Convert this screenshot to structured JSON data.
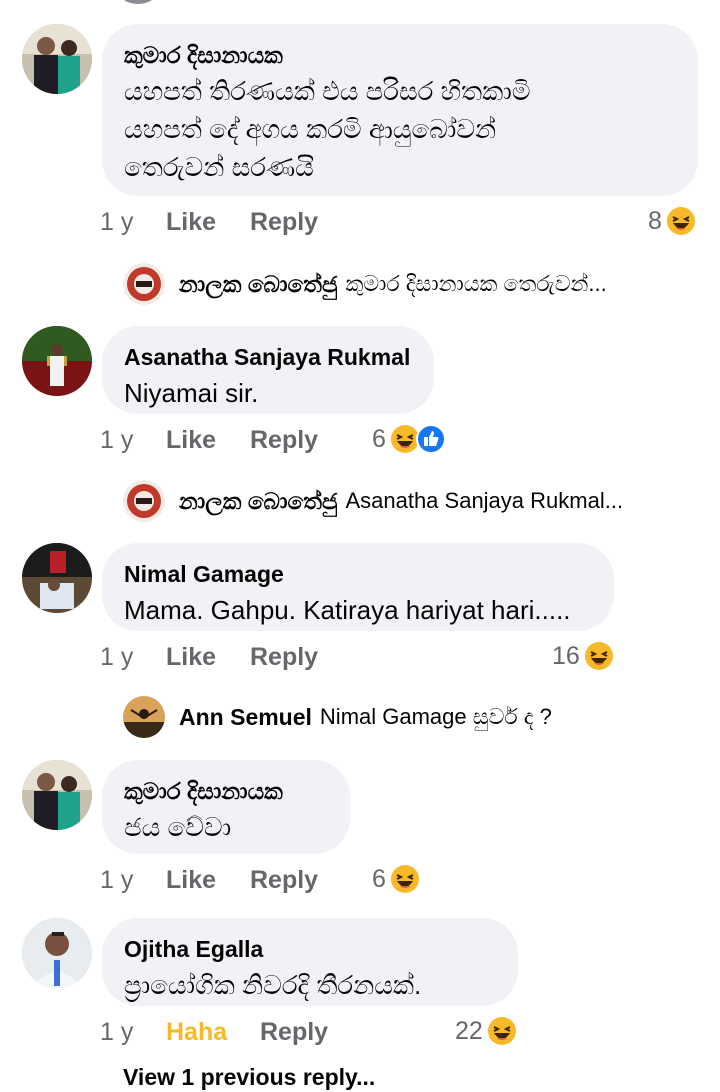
{
  "comments": [
    {
      "author": "කුමාර දිසානායක",
      "text_lines": [
        "යහපත් තිරණයක් එය පරිසර හිතකාමි",
        "යහපත් දේ අගය කරමි ආයුබෝවන්",
        "තෙරුවන් සරණයි"
      ],
      "time": "1 y",
      "like": "Like",
      "reply": "Reply",
      "reaction_count": "8",
      "reactions": [
        "haha-icon"
      ],
      "reply_preview": {
        "name": "නාලක බොතේජු",
        "text": "කුමාර දිසානායක තෙරුවන්..."
      }
    },
    {
      "author": "Asanatha Sanjaya Rukmal",
      "text_lines": [
        "Niyamai sir."
      ],
      "time": "1 y",
      "like": "Like",
      "reply": "Reply",
      "reaction_count": "6",
      "reactions": [
        "haha-icon",
        "like-icon"
      ],
      "reply_preview": {
        "name": "නාලක බොතේජු",
        "text": "Asanatha Sanjaya Rukmal..."
      }
    },
    {
      "author": "Nimal Gamage",
      "text_lines": [
        "Mama. Gahpu. Katiraya hariyat hari....."
      ],
      "time": "1 y",
      "like": "Like",
      "reply": "Reply",
      "reaction_count": "16",
      "reactions": [
        "haha-icon"
      ],
      "reply_preview": {
        "name": "Ann Semuel",
        "text": "Nimal Gamage සුවර් ද ?"
      }
    },
    {
      "author": "කුමාර දිසානායක",
      "text_lines": [
        "ජය වේවා"
      ],
      "time": "1 y",
      "like": "Like",
      "reply": "Reply",
      "reaction_count": "6",
      "reactions": [
        "haha-icon"
      ]
    },
    {
      "author": "Ojitha Egalla",
      "text_lines": [
        "ප්‍රායෝගික නිවරදි තීරනයක්."
      ],
      "time": "1 y",
      "like": "Haha",
      "reply": "Reply",
      "reaction_count": "22",
      "reactions": [
        "haha-icon"
      ]
    }
  ],
  "view_previous": "View 1 previous reply...",
  "colors": {
    "bubble": "#f0f2f5",
    "secondary_text": "#65676b",
    "haha_active": "#f7b928",
    "like_blue": "#1877f2"
  }
}
